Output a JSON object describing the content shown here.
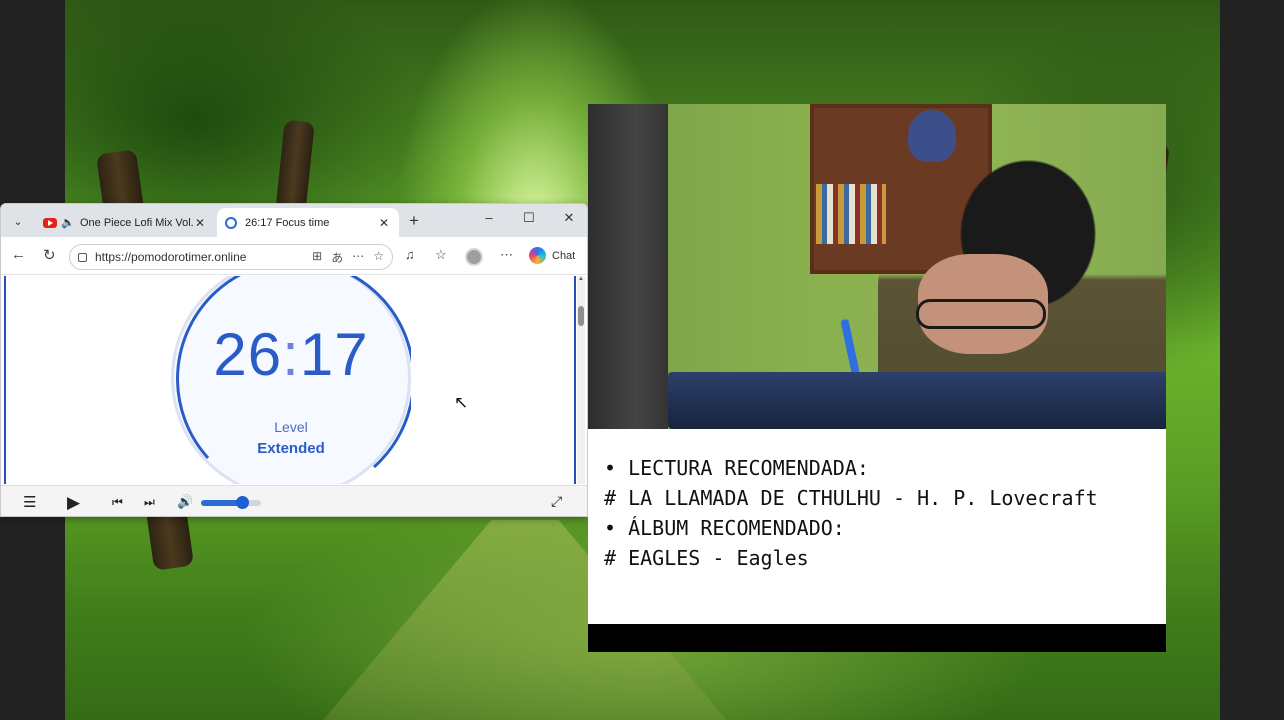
{
  "browser": {
    "tabs": [
      {
        "label": "One Piece Lofi Mix Vol.!",
        "active": false
      },
      {
        "label": "26:17 Focus time",
        "active": true
      }
    ],
    "url": "https://pomodorotimer.online",
    "chat_label": "Chat"
  },
  "timer": {
    "time_minutes": "26",
    "time_separator": ":",
    "time_seconds": "17",
    "level_label": "Level",
    "level_value": "Extended",
    "accent_color": "#2a5cc8"
  },
  "player": {
    "volume_fraction": 0.68
  },
  "notes": {
    "reading_heading": "• LECTURA RECOMENDADA:",
    "reading_title": "# LA LLAMADA DE CTHULHU - H. P. Lovecraft",
    "album_heading": "• ÁLBUM RECOMENDADO:",
    "album_title": "# EAGLES - Eagles"
  }
}
